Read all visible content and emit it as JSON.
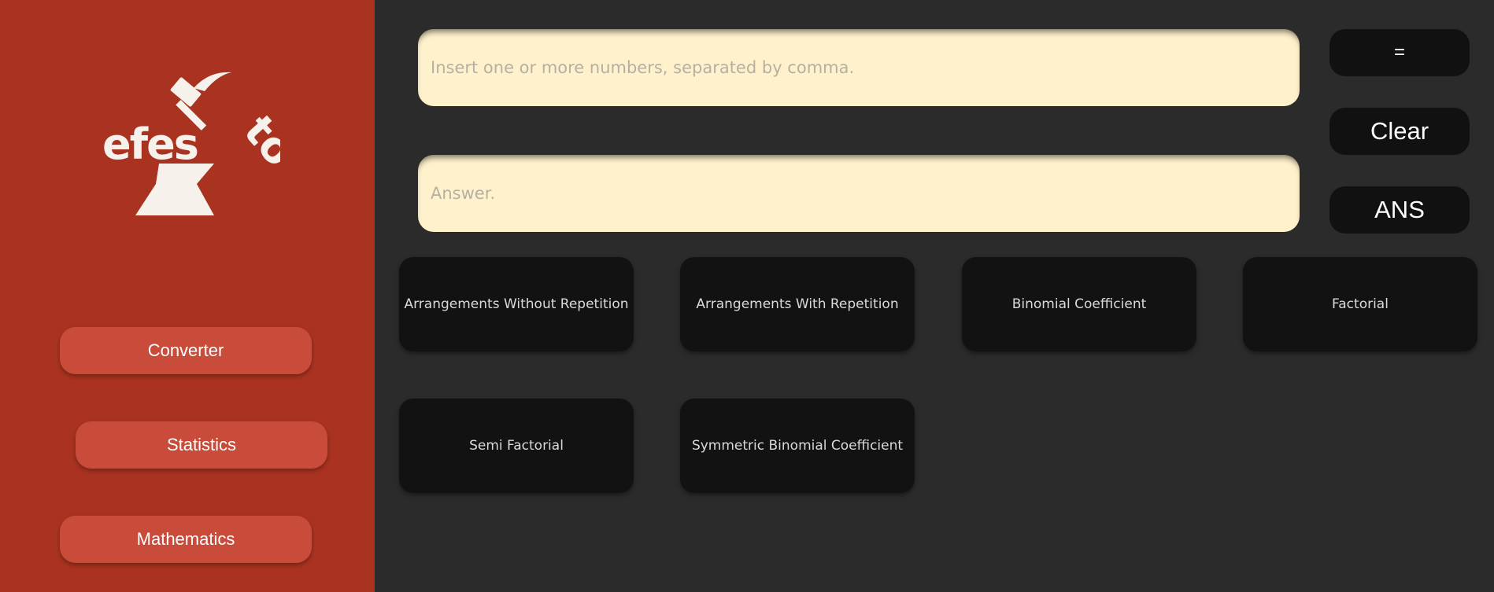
{
  "sidebar": {
    "logo_text": "efesto",
    "nav": [
      {
        "label": "Converter"
      },
      {
        "label": "Statistics"
      },
      {
        "label": "Mathematics"
      }
    ]
  },
  "main": {
    "input": {
      "placeholder": "Insert one or more numbers, separated by comma.",
      "value": ""
    },
    "answer": {
      "placeholder": "Answer.",
      "value": ""
    },
    "buttons": {
      "equals": "=",
      "clear": "Clear",
      "ans": "ANS"
    },
    "functions": [
      {
        "label": "Arrangements Without Repetition"
      },
      {
        "label": "Arrangements With Repetition"
      },
      {
        "label": "Binomial Coefficient"
      },
      {
        "label": "Factorial"
      },
      {
        "label": "Semi Factorial"
      },
      {
        "label": "Symmetric Binomial Coefficient"
      }
    ]
  },
  "colors": {
    "sidebar_bg": "#a93320",
    "nav_button": "#c94b3a",
    "main_bg": "#2b2b2b",
    "field_bg": "#fff1cc",
    "button_bg": "#111111",
    "logo": "#f6f1ea"
  }
}
